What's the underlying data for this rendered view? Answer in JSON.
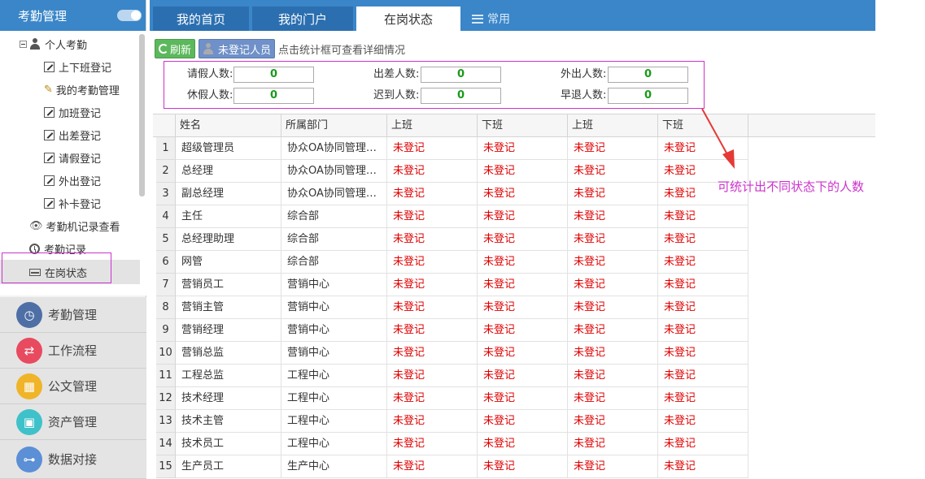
{
  "sidebar": {
    "title": "考勤管理",
    "tree": [
      {
        "label": "个人考勤",
        "icon": "user-icon"
      },
      {
        "label": "上下班登记",
        "icon": "edit-icon"
      },
      {
        "label": "我的考勤管理",
        "icon": "pencil-icon"
      },
      {
        "label": "加班登记",
        "icon": "edit-icon"
      },
      {
        "label": "出差登记",
        "icon": "edit-icon"
      },
      {
        "label": "请假登记",
        "icon": "edit-icon"
      },
      {
        "label": "外出登记",
        "icon": "edit-icon"
      },
      {
        "label": "补卡登记",
        "icon": "edit-icon"
      },
      {
        "label": "考勤机记录查看",
        "icon": "eye-icon"
      },
      {
        "label": "考勤记录",
        "icon": "clock-icon"
      },
      {
        "label": "在岗状态",
        "icon": "card-icon"
      }
    ],
    "nav": [
      {
        "label": "考勤管理",
        "color": "#4e6fa6",
        "icon": "clock-icon"
      },
      {
        "label": "工作流程",
        "color": "#e84a5f",
        "icon": "flow-icon"
      },
      {
        "label": "公文管理",
        "color": "#f0b429",
        "icon": "document-icon"
      },
      {
        "label": "资产管理",
        "color": "#3fc1c9",
        "icon": "asset-icon"
      },
      {
        "label": "数据对接",
        "color": "#5b8fd6",
        "icon": "plug-icon"
      }
    ]
  },
  "tabs": [
    {
      "label": "我的首页"
    },
    {
      "label": "我的门户"
    },
    {
      "label": "在岗状态"
    }
  ],
  "tab_common": "常用",
  "toolbar": {
    "refresh_label": "刷新",
    "unregistered_label": "未登记人员",
    "hint": "点击统计框可查看详细情况"
  },
  "stats": [
    {
      "label": "请假人数:",
      "value": "0"
    },
    {
      "label": "出差人数:",
      "value": "0"
    },
    {
      "label": "外出人数:",
      "value": "0"
    },
    {
      "label": "休假人数:",
      "value": "0"
    },
    {
      "label": "迟到人数:",
      "value": "0"
    },
    {
      "label": "早退人数:",
      "value": "0"
    }
  ],
  "grid": {
    "columns": [
      "姓名",
      "所属部门",
      "上班",
      "下班",
      "上班",
      "下班"
    ],
    "status_text": "未登记",
    "rows": [
      {
        "num": "1",
        "name": "超级管理员",
        "dept": "协众OA协同管理…"
      },
      {
        "num": "2",
        "name": "总经理",
        "dept": "协众OA协同管理…"
      },
      {
        "num": "3",
        "name": "副总经理",
        "dept": "协众OA协同管理…"
      },
      {
        "num": "4",
        "name": "主任",
        "dept": "综合部"
      },
      {
        "num": "5",
        "name": "总经理助理",
        "dept": "综合部"
      },
      {
        "num": "6",
        "name": "网管",
        "dept": "综合部"
      },
      {
        "num": "7",
        "name": "营销员工",
        "dept": "营销中心"
      },
      {
        "num": "8",
        "name": "营销主管",
        "dept": "营销中心"
      },
      {
        "num": "9",
        "name": "营销经理",
        "dept": "营销中心"
      },
      {
        "num": "10",
        "name": "营销总监",
        "dept": "营销中心"
      },
      {
        "num": "11",
        "name": "工程总监",
        "dept": "工程中心"
      },
      {
        "num": "12",
        "name": "技术经理",
        "dept": "工程中心"
      },
      {
        "num": "13",
        "name": "技术主管",
        "dept": "工程中心"
      },
      {
        "num": "14",
        "name": "技术员工",
        "dept": "工程中心"
      },
      {
        "num": "15",
        "name": "生产员工",
        "dept": "生产中心"
      }
    ]
  },
  "annotation": "可统计出不同状态下的人数",
  "colors": {
    "header_blue": "#3a86c8",
    "status_red": "#e00000",
    "count_green": "#1a9a1a",
    "highlight_magenta": "#cc33cc",
    "arrow_red": "#e53935"
  }
}
